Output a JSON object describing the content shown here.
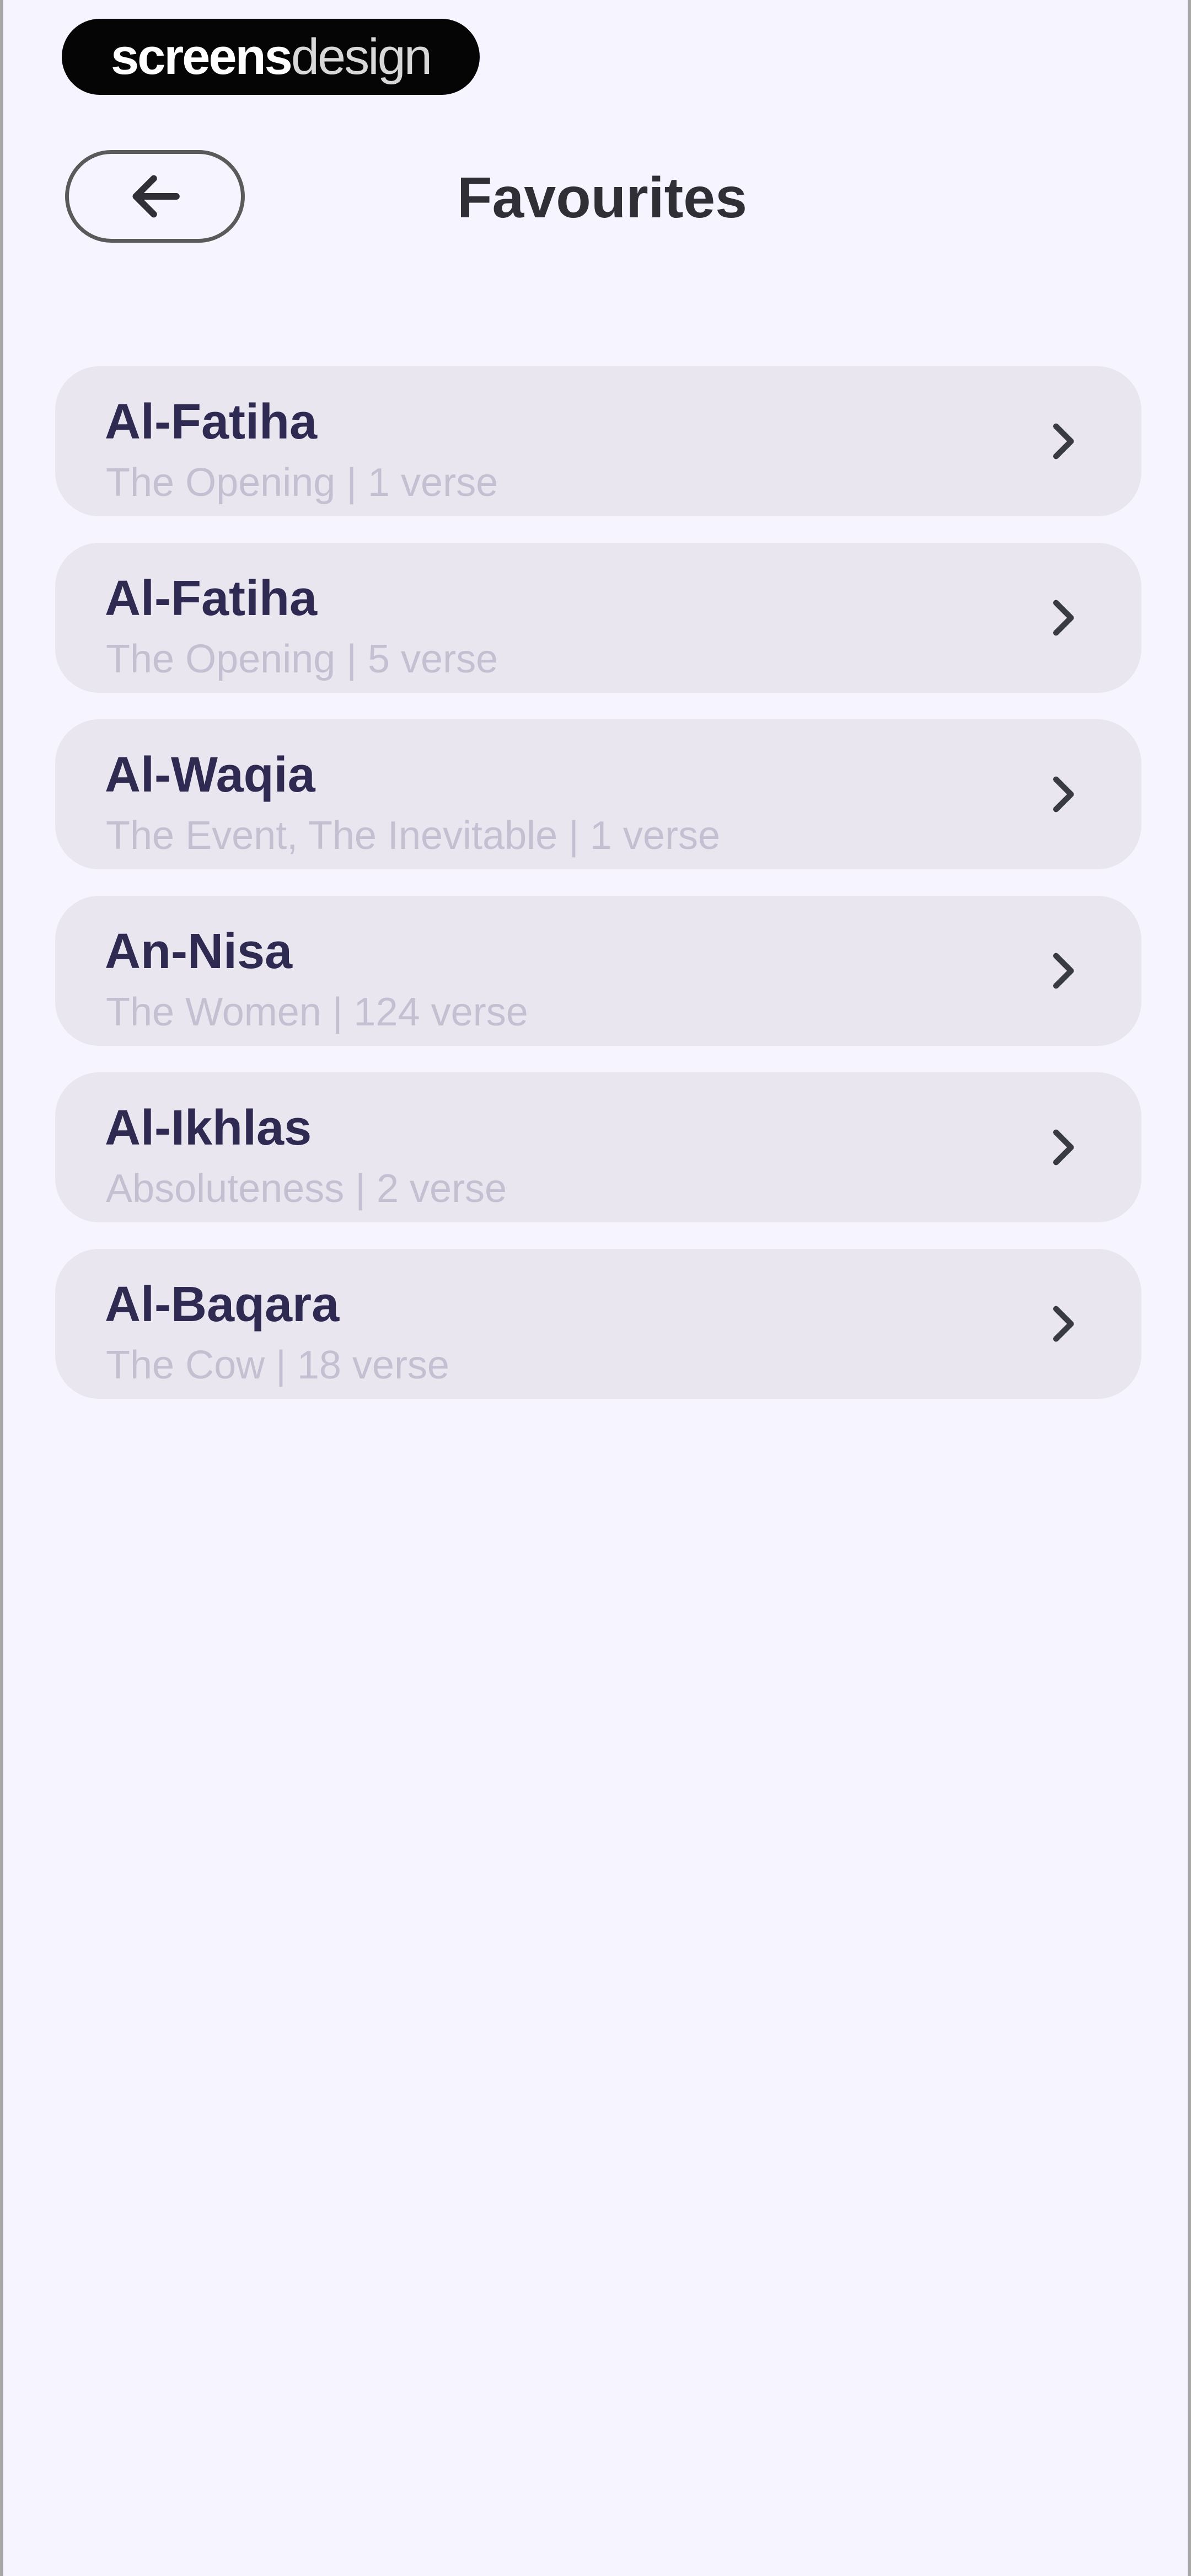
{
  "watermark": {
    "bold": "screens",
    "light": "design"
  },
  "header": {
    "title": "Favourites",
    "back_icon": "arrow-left-icon"
  },
  "favourites": [
    {
      "name": "Al-Fatiha",
      "subtitle": "The Opening | 1 verse"
    },
    {
      "name": "Al-Fatiha",
      "subtitle": "The Opening | 5 verse"
    },
    {
      "name": "Al-Waqia",
      "subtitle": "The Event, The Inevitable | 1 verse"
    },
    {
      "name": "An-Nisa",
      "subtitle": "The Women | 124 verse"
    },
    {
      "name": "Al-Ikhlas",
      "subtitle": "Absoluteness | 2 verse"
    },
    {
      "name": "Al-Baqara",
      "subtitle": "The Cow | 18 verse"
    }
  ],
  "colors": {
    "background": "#f6f4ff",
    "card": "#e9e6ef",
    "title_text": "#2f2a52",
    "subtitle_text": "#c4c0d2"
  }
}
